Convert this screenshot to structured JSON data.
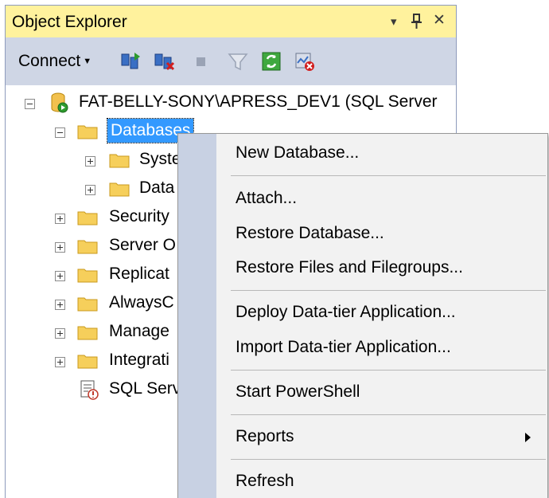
{
  "panel": {
    "title": "Object Explorer",
    "dropdown_glyph": "▾",
    "pin_glyph": "📌",
    "close_glyph": "✕",
    "connect_label": "Connect",
    "toolbar_icons": [
      "connect-object-explorer-icon",
      "disconnect-icon",
      "stop-icon",
      "filter-icon",
      "refresh-icon",
      "activity-monitor-icon"
    ]
  },
  "tree": {
    "server": "FAT-BELLY-SONY\\APRESS_DEV1 (SQL Server",
    "databases": "Databases",
    "system_db": "Syste",
    "database_snapshots": "Data",
    "security": "Security",
    "server_objects": "Server O",
    "replication": "Replicat",
    "always_on": "AlwaysC",
    "management": "Manage",
    "integration": "Integrati",
    "sql_agent": "SQL Serv"
  },
  "menu": {
    "new_database": "New Database...",
    "attach": "Attach...",
    "restore_database": "Restore Database...",
    "restore_files": "Restore Files and Filegroups...",
    "deploy_data_tier": "Deploy Data-tier Application...",
    "import_data_tier": "Import Data-tier Application...",
    "start_powershell": "Start PowerShell",
    "reports": "Reports",
    "refresh": "Refresh"
  },
  "colors": {
    "titlebar": "#fff29d",
    "toolbar": "#cfd6e5",
    "selection": "#3399ff",
    "menu_background": "#f2f2f2",
    "menu_gutter": "#c8d1e3"
  }
}
